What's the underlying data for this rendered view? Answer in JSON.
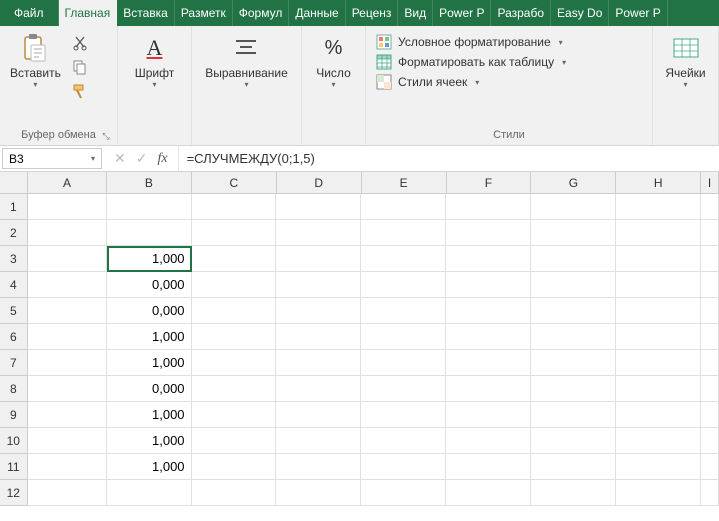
{
  "tabs": {
    "file": "Файл",
    "home": "Главная",
    "insert": "Вставка",
    "layout": "Разметк",
    "formulas": "Формул",
    "data": "Данные",
    "review": "Реценз",
    "view": "Вид",
    "powerp": "Power P",
    "dev": "Разрабо",
    "easydo": "Easy Do",
    "powerp2": "Power P"
  },
  "ribbon": {
    "clipboard": {
      "paste": "Вставить",
      "group": "Буфер обмена"
    },
    "font": {
      "label": "Шрифт"
    },
    "align": {
      "label": "Выравнивание"
    },
    "number": {
      "label": "Число",
      "symbol": "%"
    },
    "styles": {
      "cond": "Условное форматирование",
      "table": "Форматировать как таблицу",
      "cell": "Стили ячеек",
      "group": "Стили"
    },
    "cells": {
      "label": "Ячейки"
    }
  },
  "namebox": "B3",
  "formula": "=СЛУЧМЕЖДУ(0;1,5)",
  "columns": [
    "A",
    "B",
    "C",
    "D",
    "E",
    "F",
    "G",
    "H",
    "I"
  ],
  "rows": [
    "1",
    "2",
    "3",
    "4",
    "5",
    "6",
    "7",
    "8",
    "9",
    "10",
    "11",
    "12"
  ],
  "cells": {
    "B3": "1,000",
    "B4": "0,000",
    "B5": "0,000",
    "B6": "1,000",
    "B7": "1,000",
    "B8": "0,000",
    "B9": "1,000",
    "B10": "1,000",
    "B11": "1,000"
  },
  "selected": "B3"
}
